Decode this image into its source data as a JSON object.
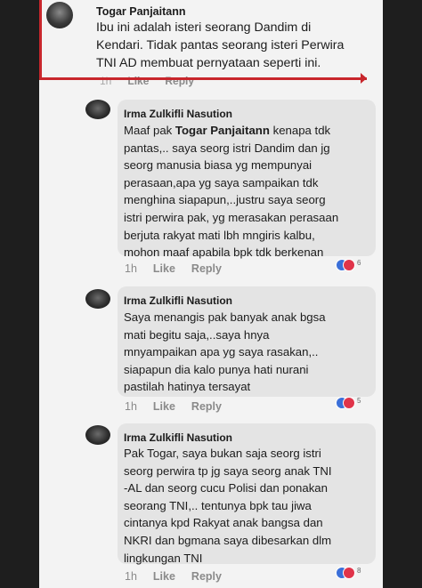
{
  "post": {
    "author": "Togar Panjaitann",
    "lines": [
      "Ibu ini adalah isteri seorang Dandim di",
      "Kendari. Tidak pantas seorang isteri Perwira",
      "TNI AD membuat pernyataan seperti ini."
    ],
    "meta_time": "1h",
    "meta_like": "Like",
    "meta_reply": "Reply"
  },
  "replies": [
    {
      "author": "Irma Zulkifli Nasution",
      "prefix": "Maaf pak ",
      "mention": "Togar Panjaitann",
      "lines": [
        " kenapa tdk",
        "pantas,.. saya seorg istri Dandim dan jg",
        "seorg manusia biasa yg mempunyai",
        "perasaan,apa yg saya sampaikan tdk",
        "menghina siapapun,..justru saya seorg",
        "istri perwira pak, yg merasakan perasaan",
        "berjuta rakyat mati lbh mngiris kalbu,",
        "mohon maaf apabila bpk tdk berkenan"
      ],
      "time": "1h",
      "like": "Like",
      "reply": "Reply",
      "reactions": "6"
    },
    {
      "author": "Irma Zulkifli Nasution",
      "lines": [
        "Saya menangis pak banyak anak bgsa",
        "mati begitu saja,..saya hnya",
        "mnyampaikan apa yg saya rasakan,..",
        "siapapun dia kalo punya hati nurani",
        "pastilah hatinya tersayat"
      ],
      "time": "1h",
      "like": "Like",
      "reply": "Reply",
      "reactions": "5"
    },
    {
      "author": "Irma Zulkifli Nasution",
      "lines": [
        "Pak Togar, saya bukan saja seorg istri",
        "seorg perwira tp jg saya seorg anak TNI",
        "-AL dan seorg cucu Polisi dan ponakan",
        "seorang TNI,.. tentunya bpk tau jiwa",
        "cintanya kpd Rakyat anak bangsa dan",
        "NKRI dan bgmana saya dibesarkan dlm",
        "lingkungan TNI"
      ],
      "time": "1h",
      "like": "Like",
      "reply": "Reply",
      "reactions": "8"
    }
  ],
  "colors": {
    "annotation": "#c8262c",
    "like_reaction": "#3b6fd8",
    "love_reaction": "#e0344a"
  }
}
